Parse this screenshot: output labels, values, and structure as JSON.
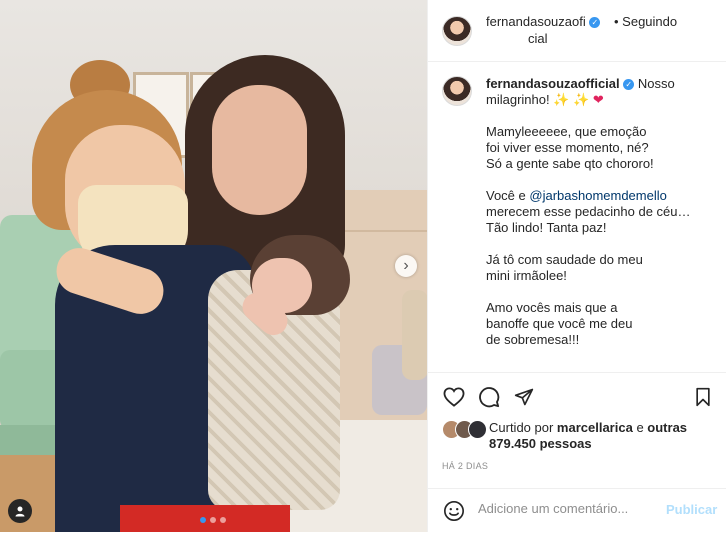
{
  "post": {
    "username_line1": "fernandasouzaofi",
    "username_line2": "cial",
    "follow_status": "• Seguindo",
    "caption_username": "fernandasouzaofficial",
    "caption_first": "Nosso milagrinho!",
    "caption_emojis": "✨ ✨",
    "caption_heart": "❤",
    "paragraph2": "Mamyleeeeee, que emoção\nfoi viver esse momento, né?\nSó a gente sabe qto chororo!",
    "paragraph3_prefix": "Você e ",
    "paragraph3_mention": "@jarbashomemdemello",
    "paragraph3_suffix": "\nmerecem esse pedacinho de céu…\nTão lindo! Tanta paz!",
    "paragraph4": "Já tô com saudade do meu\nmini irmãolee!",
    "paragraph5": "Amo vocês mais que a\nbanoffe que você me deu\nde sobremesa!!!",
    "likes_prefix": "Curtido por ",
    "likes_user": "marcellarica",
    "likes_mid": " e ",
    "likes_others": "outras 879.450 pessoas",
    "timestamp": "HÁ 2 DIAS",
    "comment_placeholder": "Adicione um comentário...",
    "publish_label": "Publicar"
  },
  "icons": {
    "verified": "✓",
    "next": "›"
  },
  "colors": {
    "accent": "#3897f0",
    "mention": "#00376b",
    "publish_disabled": "#b2dffc"
  }
}
